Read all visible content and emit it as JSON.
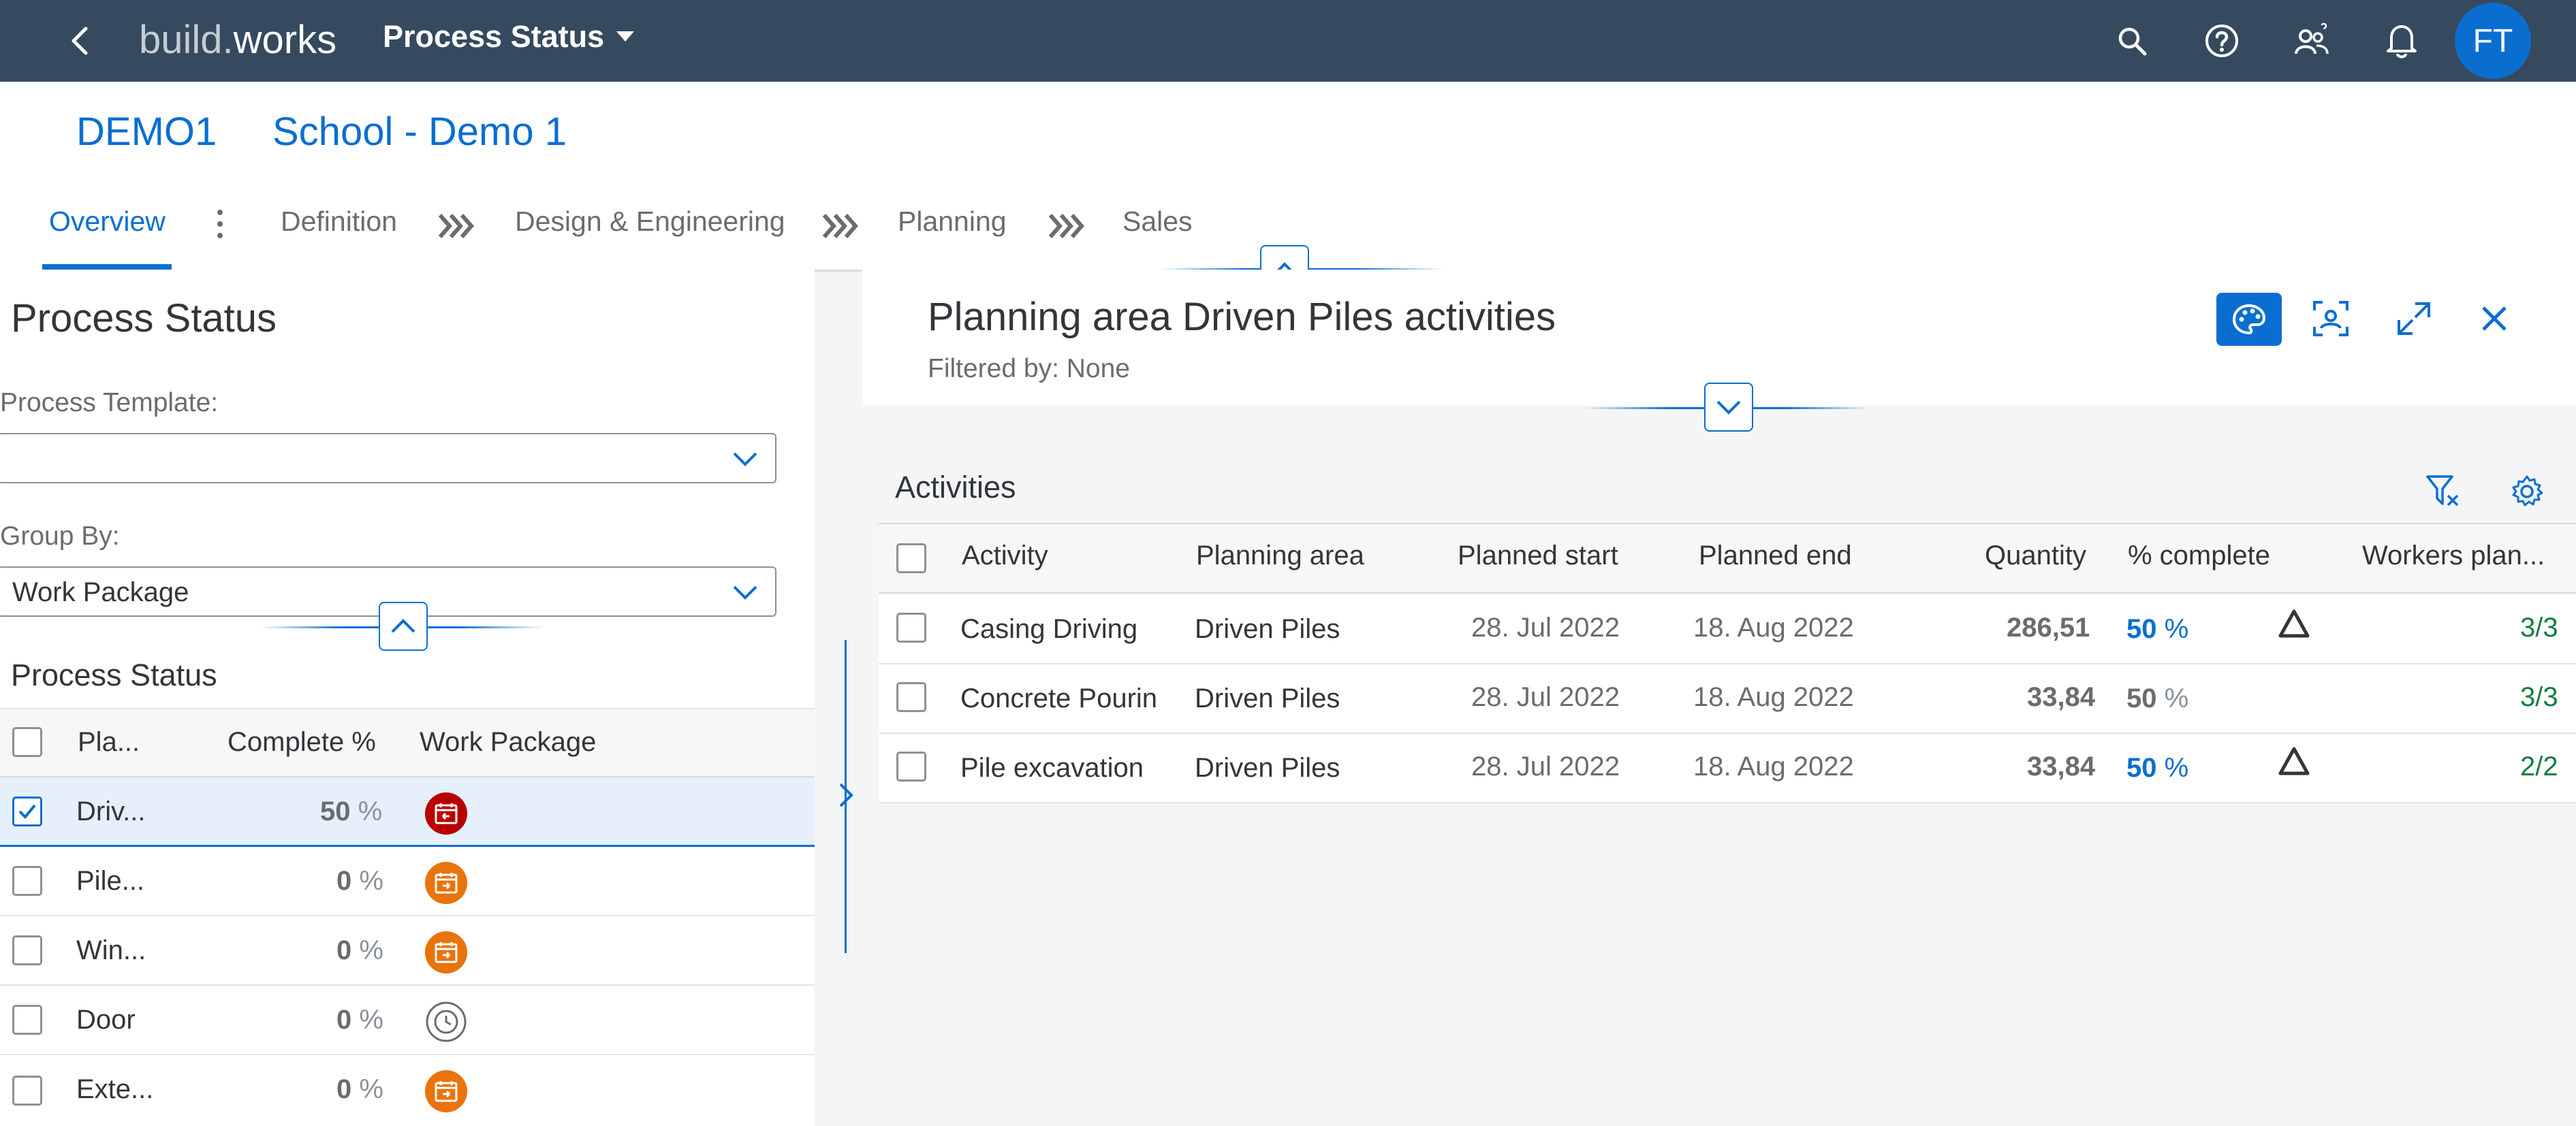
{
  "shell": {
    "brand_light": "build.",
    "brand_bold": "works",
    "title": "Process Status",
    "avatar": "FT",
    "icons": [
      "back-icon",
      "search-icon",
      "help-icon",
      "people-icon",
      "bell-icon"
    ]
  },
  "header": {
    "id": "DEMO1",
    "name": "School - Demo 1",
    "tabs": [
      "Overview",
      "Definition",
      "Design & Engineering",
      "Planning",
      "Sales"
    ]
  },
  "left": {
    "title": "Process Status",
    "template_label": "Process Template:",
    "template_value": "",
    "groupby_label": "Group By:",
    "groupby_value": "Work Package",
    "subtitle": "Process Status",
    "columns": [
      "Pla...",
      "Complete %",
      "Work Package"
    ],
    "rows": [
      {
        "name": "Driv...",
        "pct": "50",
        "sign": "%",
        "checked": true,
        "icon": "red-calendar-icon"
      },
      {
        "name": "Pile...",
        "pct": "0",
        "sign": "%",
        "checked": false,
        "icon": "orange-calendar-icon"
      },
      {
        "name": "Win...",
        "pct": "0",
        "sign": "%",
        "checked": false,
        "icon": "orange-calendar-icon"
      },
      {
        "name": "Door",
        "pct": "0",
        "sign": "%",
        "checked": false,
        "icon": "clock-icon"
      },
      {
        "name": "Exte...",
        "pct": "0",
        "sign": "%",
        "checked": false,
        "icon": "orange-calendar-icon"
      }
    ]
  },
  "right": {
    "title": "Planning area Driven Piles activities",
    "filtered": "Filtered by: None",
    "table_title": "Activities",
    "columns": [
      "Activity",
      "Planning area",
      "Planned start",
      "Planned end",
      "Quantity",
      "% complete",
      "Workers plan..."
    ],
    "rows": [
      {
        "activity": "Casing Driving",
        "area": "Driven Piles",
        "start": "28. Jul 2022",
        "end": "18. Aug 2022",
        "qty": "286,51",
        "pct": "50",
        "sign": "%",
        "warn": true,
        "workers": "3/3"
      },
      {
        "activity": "Concrete Pourin",
        "area": "Driven Piles",
        "start": "28. Jul 2022",
        "end": "18. Aug 2022",
        "qty": "33,84",
        "pct": "50",
        "sign": "%",
        "warn": false,
        "workers": "3/3"
      },
      {
        "activity": "Pile excavation",
        "area": "Driven Piles",
        "start": "28. Jul 2022",
        "end": "18. Aug 2022",
        "qty": "33,84",
        "pct": "50",
        "sign": "%",
        "warn": true,
        "workers": "2/2"
      }
    ]
  },
  "colors": {
    "shell": "#354a5f",
    "accent": "#0a6ed1",
    "green": "#107e3e",
    "orange": "#e9730c",
    "red": "#bb0000"
  }
}
